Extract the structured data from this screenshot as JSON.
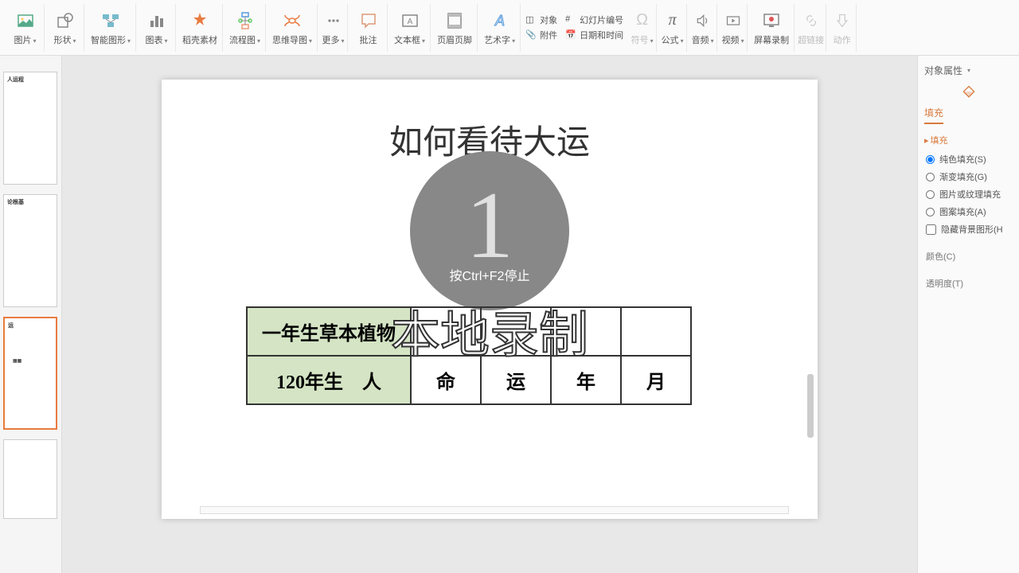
{
  "ribbon": {
    "items": [
      {
        "label": "图片",
        "icon": "image"
      },
      {
        "label": "形状",
        "icon": "shape"
      },
      {
        "label": "智能图形",
        "icon": "smart"
      },
      {
        "label": "图表",
        "icon": "chart"
      },
      {
        "label": "稻壳素材",
        "icon": "docer"
      },
      {
        "label": "流程图",
        "icon": "flow"
      },
      {
        "label": "思维导图",
        "icon": "mind"
      },
      {
        "label": "更多",
        "icon": "more"
      },
      {
        "label": "批注",
        "icon": "comment"
      },
      {
        "label": "文本框",
        "icon": "textbox"
      },
      {
        "label": "页眉页脚",
        "icon": "header"
      },
      {
        "label": "艺术字",
        "icon": "wordart"
      }
    ],
    "small1": [
      {
        "label": "对象",
        "icon": "obj"
      },
      {
        "label": "附件",
        "icon": "attach"
      }
    ],
    "small2": [
      {
        "label": "幻灯片编号",
        "icon": "num"
      },
      {
        "label": "日期和时间",
        "icon": "date"
      }
    ],
    "end": [
      {
        "label": "符号",
        "disabled": true
      },
      {
        "label": "公式",
        "disabled": false
      },
      {
        "label": "音频",
        "disabled": false
      },
      {
        "label": "视频",
        "disabled": false
      },
      {
        "label": "屏幕录制",
        "disabled": false
      },
      {
        "label": "超链接",
        "disabled": true
      },
      {
        "label": "动作",
        "disabled": true
      }
    ]
  },
  "thumbs": [
    {
      "title": "人运程"
    },
    {
      "title": "论根基"
    },
    {
      "title": "运"
    },
    {
      "title": ""
    }
  ],
  "slide": {
    "title": "如何看待大运",
    "rec_num": "1",
    "rec_text": "按Ctrl+F2停止",
    "local_rec": "本地录制",
    "table": {
      "r1": [
        "一年生草本植物",
        "",
        "",
        "",
        ""
      ],
      "r2": [
        "120年生　人",
        "命",
        "运",
        "年",
        "月"
      ]
    }
  },
  "panel": {
    "title": "对象属性",
    "tab": "填充",
    "section": "填充",
    "radios": [
      {
        "label": "纯色填充(S)",
        "checked": true
      },
      {
        "label": "渐变填充(G)",
        "checked": false
      },
      {
        "label": "图片或纹理填充",
        "checked": false
      },
      {
        "label": "图案填充(A)",
        "checked": false
      }
    ],
    "check": {
      "label": "隐藏背景图形(H"
    },
    "color": "颜色(C)",
    "trans": "透明度(T)"
  }
}
